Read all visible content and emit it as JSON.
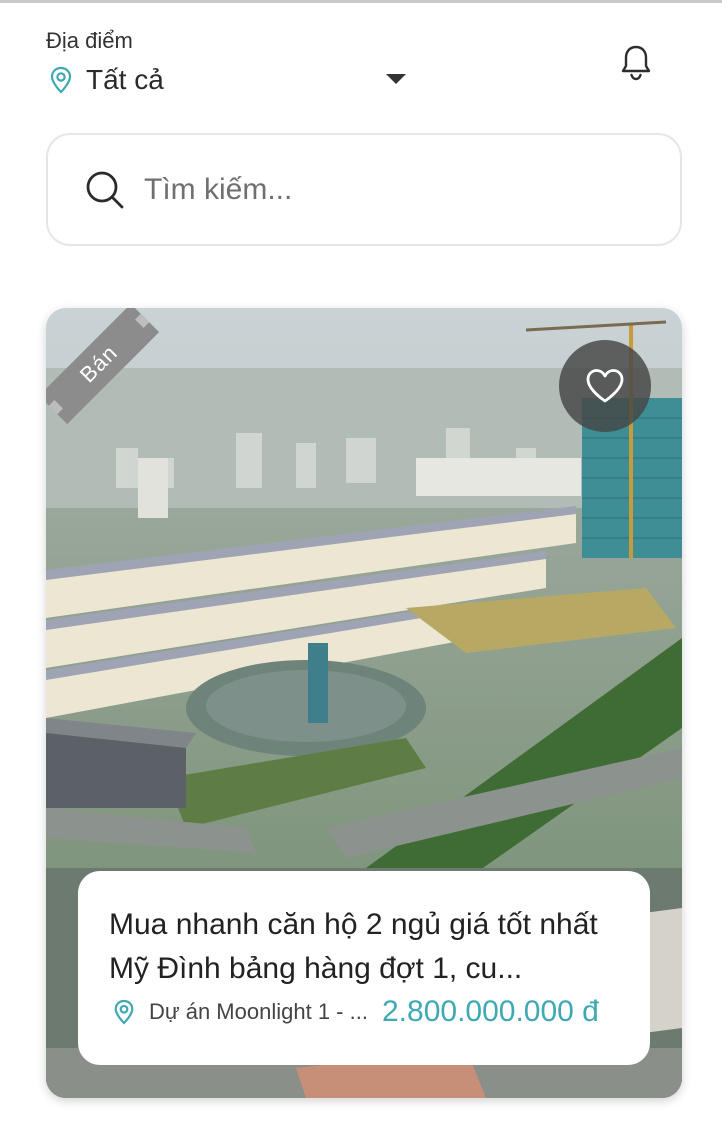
{
  "header": {
    "location_label": "Địa điểm",
    "location_value": "Tất cả"
  },
  "search": {
    "placeholder": "Tìm kiếm..."
  },
  "listing": {
    "badge": "Bán",
    "title": "Mua nhanh căn hộ 2 ngủ giá tốt nhất Mỹ Đình bảng hàng đợt 1, cu...",
    "project": "Dự án Moonlight 1 - ...",
    "price": "2.800.000.000 đ"
  },
  "icons": {
    "location": "map-pin-icon",
    "dropdown": "caret-down-icon",
    "notification": "bell-icon",
    "search": "search-icon",
    "favorite": "heart-icon"
  },
  "colors": {
    "accent": "#3fa9b2",
    "badge": "#8c8c8c"
  }
}
